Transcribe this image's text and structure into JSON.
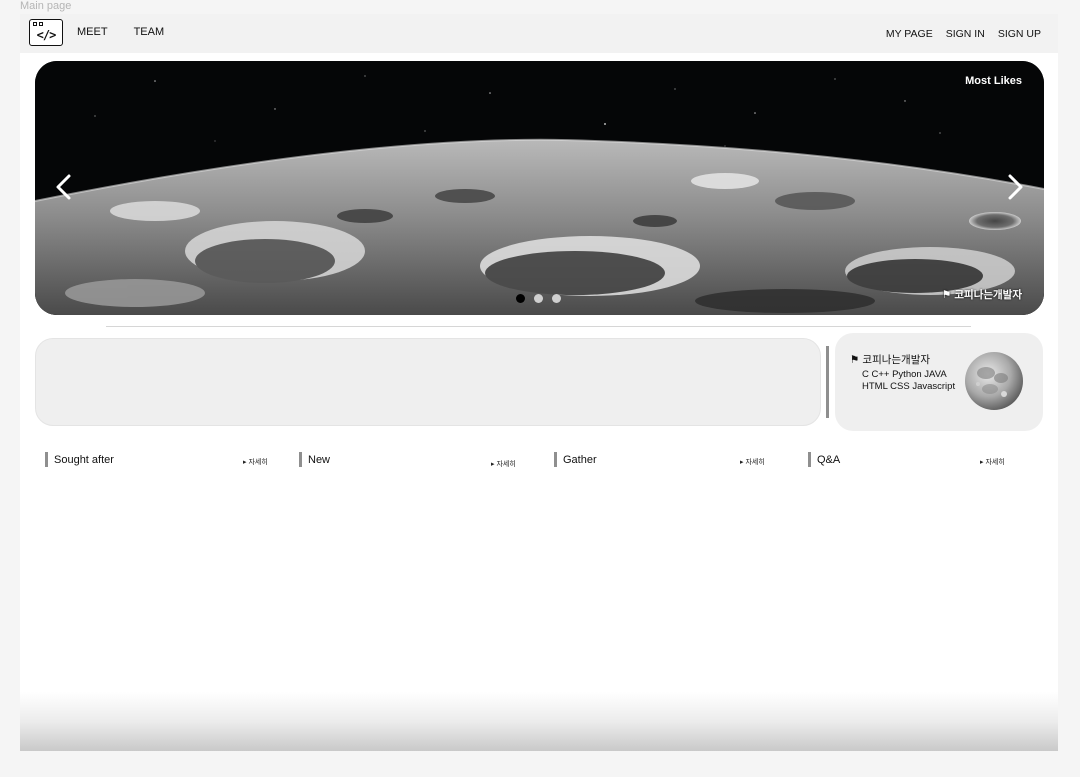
{
  "frame": {
    "label": "Main page"
  },
  "nav": {
    "logo_glyph": "</>",
    "left": [
      "MEET",
      "TEAM"
    ],
    "right": [
      "MY PAGE",
      "SIGN IN",
      "SIGN UP"
    ]
  },
  "hero": {
    "badge": "Most Likes",
    "credit": "코피나는개발자",
    "slide_count": 3,
    "active_slide": 1
  },
  "profile": {
    "name": "코피나는개발자",
    "skills": "C C++ Python JAVA HTML CSS Javascript"
  },
  "sections": [
    {
      "title": "Sought after",
      "more": "자세히"
    },
    {
      "title": "New",
      "more": "자세히"
    },
    {
      "title": "Gather",
      "more": "자세히"
    },
    {
      "title": "Q&A",
      "more": "자세히"
    }
  ],
  "icons": {
    "flag": "flag-icon",
    "prev": "chevron-left-icon",
    "next": "chevron-right-icon",
    "logo": "code-window-icon"
  }
}
